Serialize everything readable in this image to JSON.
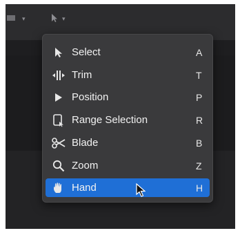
{
  "menu": {
    "items": [
      {
        "label": "Select",
        "shortcut": "A",
        "icon": "arrow-pointer-icon"
      },
      {
        "label": "Trim",
        "shortcut": "T",
        "icon": "trim-icon"
      },
      {
        "label": "Position",
        "shortcut": "P",
        "icon": "position-arrow-icon"
      },
      {
        "label": "Range Selection",
        "shortcut": "R",
        "icon": "range-selection-icon"
      },
      {
        "label": "Blade",
        "shortcut": "B",
        "icon": "scissors-icon"
      },
      {
        "label": "Zoom",
        "shortcut": "Z",
        "icon": "magnifier-icon"
      },
      {
        "label": "Hand",
        "shortcut": "H",
        "icon": "hand-icon",
        "selected": true
      }
    ]
  },
  "colors": {
    "selection": "#1f6fd6",
    "menu_bg": "#3a3a3c",
    "app_bg": "#262628"
  }
}
